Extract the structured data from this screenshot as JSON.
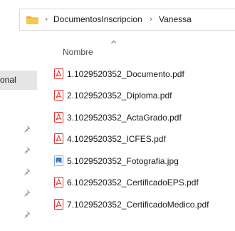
{
  "address_bar": {
    "crumbs": [
      "DocumentosInscripcion",
      "Vanessa"
    ],
    "folder_icon": "folder-icon",
    "separator_icon": "chevron-right-icon"
  },
  "nav_pane": {
    "selected_item_partial_label": "onal",
    "pin_icon": "pin-icon"
  },
  "column_header": {
    "name_label": "Nombre",
    "sort": "ascending"
  },
  "files": [
    {
      "name": "1.1029520352_Documento.pdf",
      "icon": "pdf-icon"
    },
    {
      "name": "2.1029520352_Diploma.pdf",
      "icon": "pdf-icon"
    },
    {
      "name": "3.1029520352_ActaGrado.pdf",
      "icon": "pdf-icon"
    },
    {
      "name": "4.1029520352_ICFES.pdf",
      "icon": "pdf-icon"
    },
    {
      "name": "5.1029520352_Fotografia.jpg",
      "icon": "image-icon"
    },
    {
      "name": "6.1029520352_CertificadoEPS.pdf",
      "icon": "pdf-icon"
    },
    {
      "name": "7.1029520352_CertificadoMedico.pdf",
      "icon": "pdf-icon"
    }
  ],
  "colors": {
    "pdf_red": "#e0332c",
    "folder_yellow": "#f4c542",
    "image_blue": "#3a78c9",
    "selected_nav_bg": "#e5e5e5"
  }
}
